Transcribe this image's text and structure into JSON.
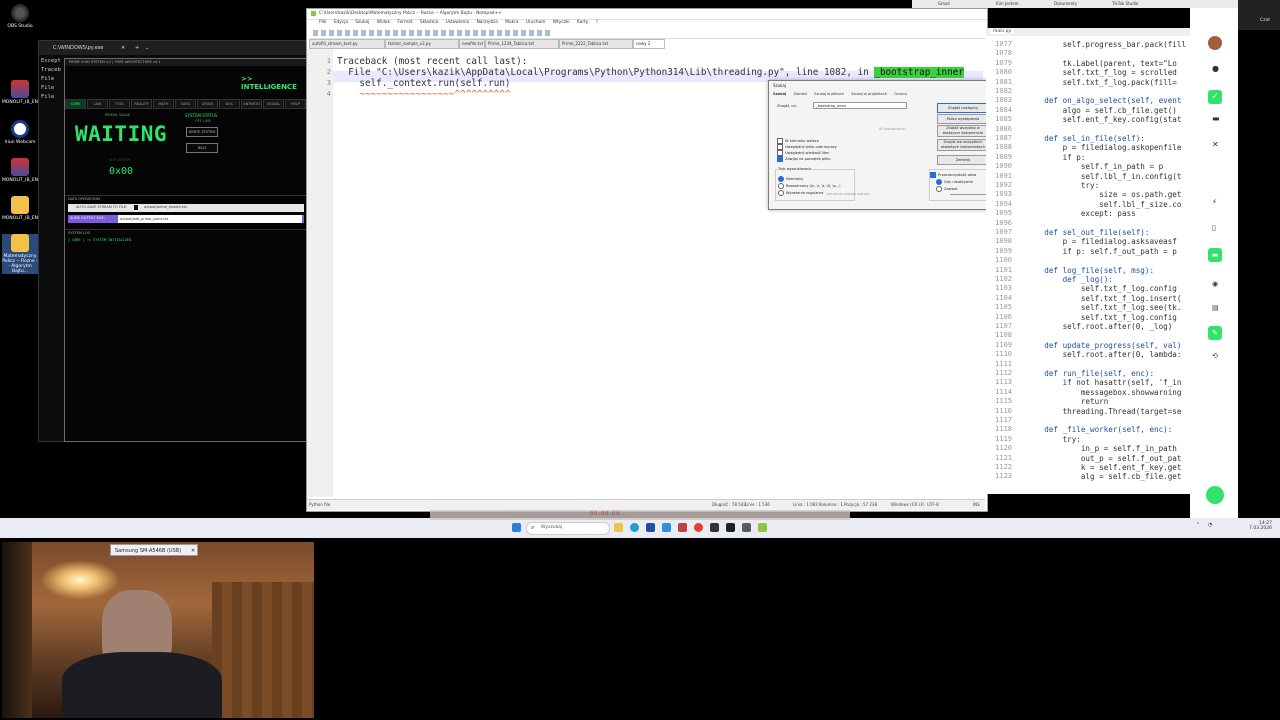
{
  "desktop": {
    "icons": [
      {
        "label": "OBS Studio",
        "icon": "obs-icon"
      },
      {
        "label": "MONOLIT_IB_EN...",
        "icon": "app-icon"
      },
      {
        "label": "Iriun Webcam",
        "icon": "webcam-icon"
      },
      {
        "label": "MONOLIT_IB_EN...",
        "icon": "app-icon"
      },
      {
        "label": "MONOLIT_IB_EN...",
        "icon": "folder-icon"
      },
      {
        "label": "Matematyczny Policz -- Rozne -- Algorytm Bajtu...",
        "icon": "folder-icon"
      }
    ]
  },
  "console": {
    "title": "C:\\WINDOWS\\py.exe",
    "lines": [
      "Except",
      "Traceb",
      "  File",
      "",
      "  File",
      "",
      "  File"
    ]
  },
  "tk_app": {
    "title": "PRIME VOID SYSTEM v.2 | PURE ARCHITECTURE v4.1",
    "header": ">> INTELLIGENCE",
    "subheader": "CORE | LAW | TOOL | ",
    "tabs": [
      "CORE",
      "LAW",
      "TOOL",
      "REALITY",
      "MATH",
      "DATA",
      "CRISIS",
      "DOC",
      "ANTIMOD",
      "SIGNAL",
      "HELP"
    ],
    "status_small": "PRIMAL VALUE",
    "status": "WAITING",
    "system_status_label": "SYSTEM STATUS",
    "system_status_value": "OFF-LINE",
    "btn_ignite": "IGNITE SYSTEM",
    "btn_halt": "HALT",
    "key_label": "AUX DRIVER",
    "key_value": "0x00",
    "data_section": "DATA OPERATIONS",
    "autosave_label": "AUTO-SAVE STREAM TO FILE:",
    "autosave_value": "output/prime_stream.txt",
    "sums_label": "SUMS OUTPUT FILE:",
    "sums_value": "output/odd_prime_sums.txt",
    "log_section": "SYSTEM LOG",
    "log_line": "[ CORE ] >> SYSTEM INITIALIZED"
  },
  "npp": {
    "title": "C:\\Users\\kazik\\Desktop\\Matematyczny Policz -- Rozne -- Algorytm Bajtu - Notepad++",
    "menu": [
      "Plik",
      "Edycja",
      "Szukaj",
      "Widok",
      "Format",
      "Składnia",
      "Ustawienia",
      "Narzędzia",
      "Makra",
      "Uruchom",
      "Wtyczki",
      "Karty",
      "?"
    ],
    "tabs": [
      "autofill_stream_test.py",
      "tkinter_sample_v2.py",
      "newfile.txt",
      "Prime_1234_Tablica.txt",
      "Prime_2222_Tablica.txt",
      "nowy 2"
    ],
    "lines": [
      {
        "n": "1",
        "text": "Traceback (most recent call last):"
      },
      {
        "n": "2",
        "text": "  File \"C:\\Users\\kazik\\AppData\\Local\\Programs\\Python\\Python314\\Lib\\threading.py\", line 1082, in ",
        "hl": "_bootstrap_inner"
      },
      {
        "n": "3",
        "text": "    self._context.run(self.run)"
      },
      {
        "n": "4",
        "text": "    ~~~~~~~~~~~~~~~~~^^^^^^^^^^"
      }
    ],
    "status_left": "Python file",
    "status_len": "Długość : 78 543",
    "status_lines": "Linie : 1 536",
    "status_pos": "Linia : 1 062    Kolumna : 1    Pozycja : 57 238",
    "status_eol": "Windows (CR LF)",
    "status_enc": "UTF-8",
    "status_ins": "INS"
  },
  "find": {
    "title": "Szukaj",
    "tabs": [
      "Szukaj",
      "Zamień",
      "Szukaj w plikach",
      "Szukaj w projektach",
      "Oznacz"
    ],
    "find_label": "Znajdź, co:",
    "find_value": "_bootstrap_inner",
    "btn_next": "Znajdź następny",
    "btn_count": "Policz wystąpienia",
    "btn_all_open": "Znajdź we wszystkich otwartych dokumentach",
    "btn_all_current": "Znajdź wszystko w bieżącym dokumencie",
    "btn_close": "Zamknij",
    "cb_backward": "W kierunku wstecz",
    "cb_whole": "Uwzględnij tylko całe wyrazy",
    "cb_case": "Uwzględnij wielkość liter",
    "cb_wrap": "Zawijaj na początek pliku",
    "in_selection": "W zaznaczeniu",
    "mode_title": "Tryb wyszukiwania",
    "mode_normal": "Normalny",
    "mode_extended": "Rozszerzony (\\n, \\r, \\t, \\0, \\x...)",
    "mode_regex": "Wyrażenie regularne",
    "dot_nl": ". pasuje do nowego wiersza",
    "transparency": "Przezroczystość okna",
    "trans_focus": "Gdy nieaktywne",
    "trans_always": "Zawsze"
  },
  "right_editor": {
    "tab": "main.py",
    "lines": [
      {
        "n": "1077",
        "html": "        self.progress_bar.pack(fill"
      },
      {
        "n": "1078",
        "html": ""
      },
      {
        "n": "1079",
        "html": "        tk.Label(parent, text=\"Lo"
      },
      {
        "n": "1080",
        "html": "        self.txt_f_log = scrolled"
      },
      {
        "n": "1081",
        "html": "        self.txt_f_log.pack(fill="
      },
      {
        "n": "1082",
        "html": ""
      },
      {
        "n": "1083",
        "html": "    def on_algo_select(self, event"
      },
      {
        "n": "1084",
        "html": "        algo = self.cb_file.get()"
      },
      {
        "n": "1085",
        "html": "        self.ent_f_key.config(stat"
      },
      {
        "n": "1086",
        "html": ""
      },
      {
        "n": "1087",
        "html": "    def sel_in_file(self):"
      },
      {
        "n": "1088",
        "html": "        p = filedialog.askopenfile"
      },
      {
        "n": "1089",
        "html": "        if p:"
      },
      {
        "n": "1090",
        "html": "            self.f_in_path = p"
      },
      {
        "n": "1091",
        "html": "            self.lbl_f_in.config(t"
      },
      {
        "n": "1092",
        "html": "            try:"
      },
      {
        "n": "1093",
        "html": "                size = os.path.get"
      },
      {
        "n": "1094",
        "html": "                self.lbl_f_size.co"
      },
      {
        "n": "1095",
        "html": "            except: pass"
      },
      {
        "n": "1096",
        "html": ""
      },
      {
        "n": "1097",
        "html": "    def sel_out_file(self):"
      },
      {
        "n": "1098",
        "html": "        p = filedialog.asksaveasf"
      },
      {
        "n": "1099",
        "html": "        if p: self.f_out_path = p"
      },
      {
        "n": "1100",
        "html": ""
      },
      {
        "n": "1101",
        "html": "    def log_file(self, msg):"
      },
      {
        "n": "1102",
        "html": "        def _log():"
      },
      {
        "n": "1103",
        "html": "            self.txt_f_log.config"
      },
      {
        "n": "1104",
        "html": "            self.txt_f_log.insert("
      },
      {
        "n": "1105",
        "html": "            self.txt_f_log.see(tk."
      },
      {
        "n": "1106",
        "html": "            self.txt_f_log.config"
      },
      {
        "n": "1107",
        "html": "        self.root.after(0, _log)"
      },
      {
        "n": "1108",
        "html": ""
      },
      {
        "n": "1109",
        "html": "    def update_progress(self, val)"
      },
      {
        "n": "1110",
        "html": "        self.root.after(0, lambda:"
      },
      {
        "n": "1111",
        "html": ""
      },
      {
        "n": "1112",
        "html": "    def run_file(self, enc):"
      },
      {
        "n": "1113",
        "html": "        if not hasattr(self, 'f_in"
      },
      {
        "n": "1114",
        "html": "            messagebox.showwarning"
      },
      {
        "n": "1115",
        "html": "            return"
      },
      {
        "n": "1116",
        "html": "        threading.Thread(target=se"
      },
      {
        "n": "1117",
        "html": ""
      },
      {
        "n": "1118",
        "html": "    def _file_worker(self, enc):"
      },
      {
        "n": "1119",
        "html": "        try:"
      },
      {
        "n": "1120",
        "html": "            in_p = self.f_in_path"
      },
      {
        "n": "1121",
        "html": "            out_p = self.f_out_pat"
      },
      {
        "n": "1122",
        "html": "            k = self.ent_f_key.get"
      },
      {
        "n": "1123",
        "html": "            alg = self.cb_file.get"
      }
    ]
  },
  "webcam": {
    "source_label": "Samsung SM-A546B (USB)"
  },
  "taskbar": {
    "search_placeholder": "Wyszukaj",
    "recording_label": "00:00:00",
    "time": "14:27",
    "date": "7.03.2026"
  },
  "browser": {
    "tabs": [
      "Gmail",
      "Kim Jestem",
      "Dokumenty",
      "TikTok Studio"
    ],
    "chat_label": "Czat"
  },
  "colors": {
    "accent_green": "#2fe36b",
    "highlight": "#3cd13c",
    "taskbar_bg": "#e9edf3"
  }
}
